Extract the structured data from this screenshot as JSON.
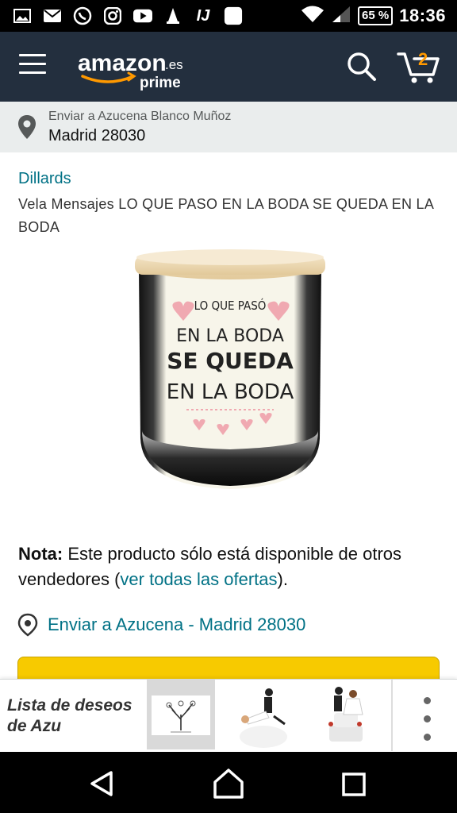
{
  "status_bar": {
    "battery": "65 %",
    "time": "18:36",
    "carrier_mark": "IJ"
  },
  "header": {
    "logo_text": "amazon",
    "logo_suffix": ".es",
    "logo_sub": "prime",
    "cart_count": "2",
    "colors": {
      "background": "#232f3e",
      "accent": "#ff9900"
    }
  },
  "address_bar": {
    "line1": "Enviar a Azucena Blanco Muñoz",
    "line2": "Madrid 28030"
  },
  "product": {
    "brand": "Dillards",
    "title": "Vela Mensajes LO QUE PASO EN LA BODA SE QUEDA EN LA BODA",
    "image_text": {
      "line1": "LO QUE PASÓ",
      "line2": "EN LA BODA",
      "line3": "SE QUEDA",
      "line4": "EN LA BODA"
    }
  },
  "note": {
    "label": "Nota:",
    "text": " Este producto sólo está disponible de otros vendedores (",
    "link": "ver todas las ofertas",
    "end": ")."
  },
  "delivery": {
    "text": "Enviar a Azucena - Madrid 28030"
  },
  "wishlist": {
    "title": "Lista de deseos de Azu",
    "items": [
      "guestbook-tree-thumbnail",
      "wedding-couple-figurine-thumbnail",
      "wedding-cake-topper-thumbnail"
    ]
  },
  "icons": [
    "menu-icon",
    "search-icon",
    "cart-icon",
    "location-pin-icon",
    "back-icon",
    "home-icon",
    "recents-icon"
  ]
}
